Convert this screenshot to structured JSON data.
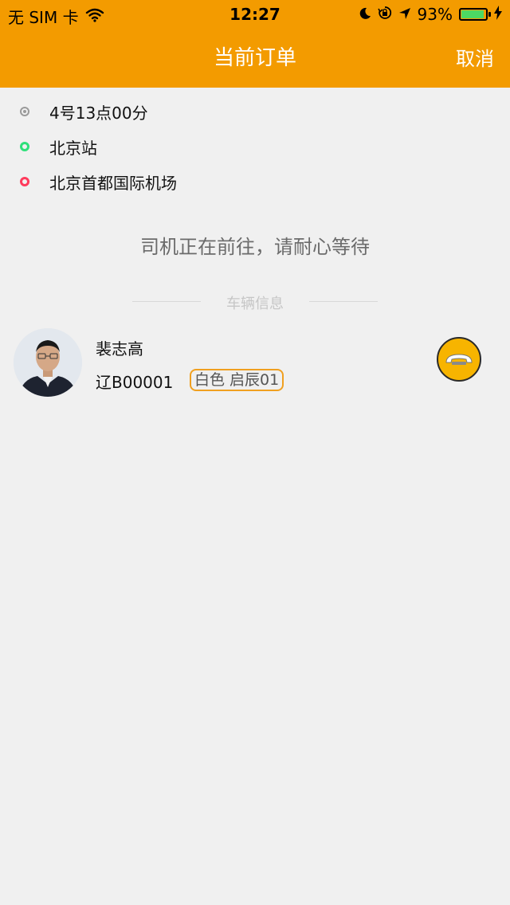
{
  "status_bar": {
    "carrier": "无 SIM 卡",
    "time": "12:27",
    "battery_percent": "93%",
    "battery_level": 0.93
  },
  "nav": {
    "title": "当前订单",
    "cancel": "取消"
  },
  "route": {
    "time": "4号13点00分",
    "start": "北京站",
    "end": "北京首都国际机场"
  },
  "status_message": "司机正在前往，请耐心等待",
  "section_label": "车辆信息",
  "driver": {
    "name": "裴志高",
    "plate": "辽B00001",
    "car": "白色 启辰01"
  },
  "colors": {
    "brand": "#f39b00",
    "start_dot": "#2ee07a",
    "end_dot": "#ff3b5c",
    "time_dot": "#9a9a9a",
    "call_button": "#f7b400"
  },
  "icons": {
    "wifi": "wifi-icon",
    "moon": "moon-icon",
    "rotation_lock": "rotation-lock-icon",
    "location": "location-arrow-icon",
    "battery": "battery-icon",
    "charging": "charging-icon",
    "call": "phone-icon"
  }
}
